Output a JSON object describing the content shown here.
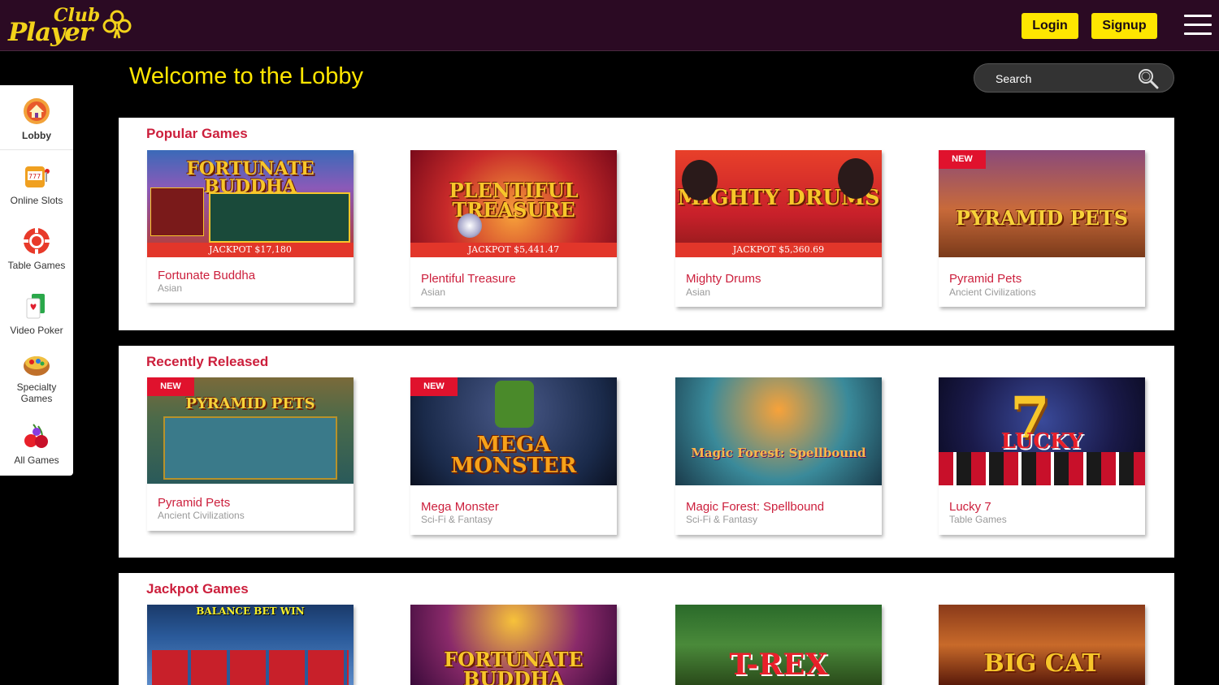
{
  "header": {
    "logo": {
      "club": "Club",
      "player": "Player"
    },
    "login_label": "Login",
    "signup_label": "Signup"
  },
  "sidebar": {
    "items": [
      {
        "label": "Lobby",
        "icon": "house-icon",
        "active": true
      },
      {
        "label": "Online Slots",
        "icon": "slot-machine-icon",
        "active": false
      },
      {
        "label": "Table Games",
        "icon": "poker-chip-icon",
        "active": false
      },
      {
        "label": "Video Poker",
        "icon": "playing-cards-icon",
        "active": false
      },
      {
        "label": "Specialty Games",
        "icon": "bingo-drum-icon",
        "active": false
      },
      {
        "label": "All Games",
        "icon": "cherries-icon",
        "active": false
      }
    ]
  },
  "main": {
    "title": "Welcome to the Lobby",
    "search": {
      "placeholder": "Search"
    }
  },
  "sections": [
    {
      "title": "Popular Games",
      "games": [
        {
          "name": "Fortunate Buddha",
          "category": "Asian",
          "thumb_text": "FORTUNATE BUDDHA",
          "jackpot": "JACKPOT $17,180",
          "badge": ""
        },
        {
          "name": "Plentiful Treasure",
          "category": "Asian",
          "thumb_text": "PLENTIFUL TREASURE",
          "jackpot": "JACKPOT $5,441.47",
          "badge": ""
        },
        {
          "name": "Mighty Drums",
          "category": "Asian",
          "thumb_text": "MIGHTY DRUMS",
          "jackpot": "JACKPOT $5,360.69",
          "badge": ""
        },
        {
          "name": "Pyramid Pets",
          "category": "Ancient Civilizations",
          "thumb_text": "PYRAMID PETS",
          "jackpot": "",
          "badge": "NEW"
        }
      ]
    },
    {
      "title": "Recently Released",
      "games": [
        {
          "name": "Pyramid Pets",
          "category": "Ancient Civilizations",
          "thumb_text": "PYRAMID PETS",
          "jackpot": "",
          "badge": "NEW"
        },
        {
          "name": "Mega Monster",
          "category": "Sci-Fi & Fantasy",
          "thumb_text": "MEGA MONSTER",
          "jackpot": "",
          "badge": "NEW"
        },
        {
          "name": "Magic Forest: Spellbound",
          "category": "Sci-Fi & Fantasy",
          "thumb_text": "Magic Forest: Spellbound",
          "jackpot": "",
          "badge": ""
        },
        {
          "name": "Lucky 7",
          "category": "Table Games",
          "thumb_text": "LUCKY",
          "jackpot": "",
          "badge": ""
        }
      ]
    },
    {
      "title": "Jackpot Games",
      "games": [
        {
          "name": "",
          "category": "",
          "thumb_text": "BALANCE  BET  WIN",
          "jackpot": "",
          "badge": ""
        },
        {
          "name": "",
          "category": "",
          "thumb_text": "FORTUNATE BUDDHA",
          "jackpot": "",
          "badge": ""
        },
        {
          "name": "",
          "category": "",
          "thumb_text": "T-REX",
          "jackpot": "",
          "badge": ""
        },
        {
          "name": "",
          "category": "",
          "thumb_text": "BIG CAT",
          "jackpot": "",
          "badge": ""
        }
      ]
    }
  ],
  "colors": {
    "header_bg": "#2b0a23",
    "accent_yellow": "#ffe600",
    "title_red": "#cc1f3c",
    "jackpot_bar": "#e2362a",
    "badge_red": "#e0122d"
  }
}
